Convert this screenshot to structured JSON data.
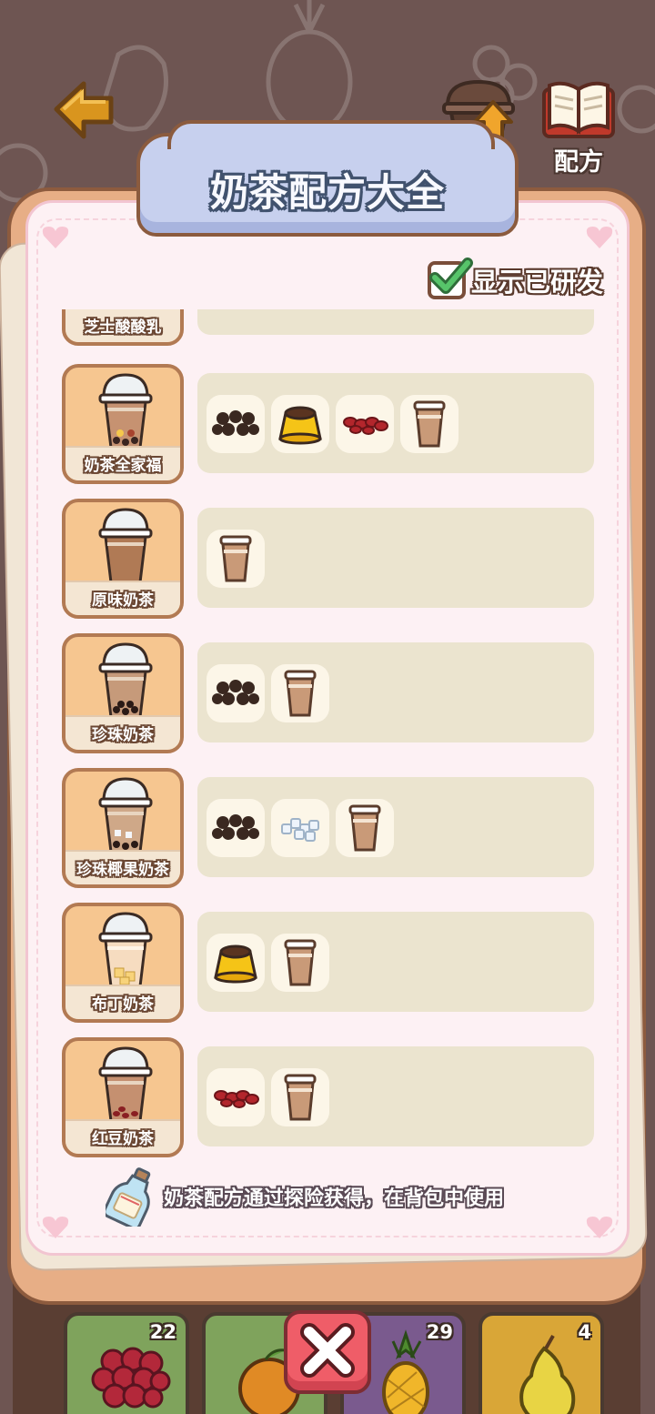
{
  "header": {
    "upgrade_label": "升级",
    "recipe_book_label": "配方"
  },
  "dialog": {
    "title": "奶茶配方大全",
    "show_developed_label": "显示已研发",
    "show_developed_checked": true,
    "hint_text": "奶茶配方通过探险获得，在背包中使用"
  },
  "recipes": [
    {
      "name": "芝士酸酸乳",
      "ingredients": []
    },
    {
      "name": "奶茶全家福",
      "ingredients": [
        "pearls-icon",
        "pudding-icon",
        "red-bean-icon",
        "milk-tea-cup-icon"
      ]
    },
    {
      "name": "原味奶茶",
      "ingredients": [
        "milk-tea-cup-icon"
      ]
    },
    {
      "name": "珍珠奶茶",
      "ingredients": [
        "pearls-icon",
        "milk-tea-cup-icon"
      ]
    },
    {
      "name": "珍珠椰果奶茶",
      "ingredients": [
        "pearls-icon",
        "coconut-jelly-icon",
        "milk-tea-cup-icon"
      ]
    },
    {
      "name": "布丁奶茶",
      "ingredients": [
        "pudding-icon",
        "milk-tea-cup-icon"
      ]
    },
    {
      "name": "红豆奶茶",
      "ingredients": [
        "red-bean-icon",
        "milk-tea-cup-icon"
      ]
    }
  ],
  "inventory": [
    {
      "item": "grape-icon",
      "count": "22",
      "color": "#7fa35c"
    },
    {
      "item": "orange-icon",
      "count": "",
      "color": "#7fa35c"
    },
    {
      "item": "pineapple-icon",
      "count": "29",
      "color": "#7a5a8e"
    },
    {
      "item": "pear-icon",
      "count": "4",
      "color": "#d9a637"
    }
  ],
  "colors": {
    "board": "#e7ae86",
    "paper": "#fdf1f4",
    "title_banner": "#c7d0ee",
    "close_button": "#ef5d68"
  }
}
